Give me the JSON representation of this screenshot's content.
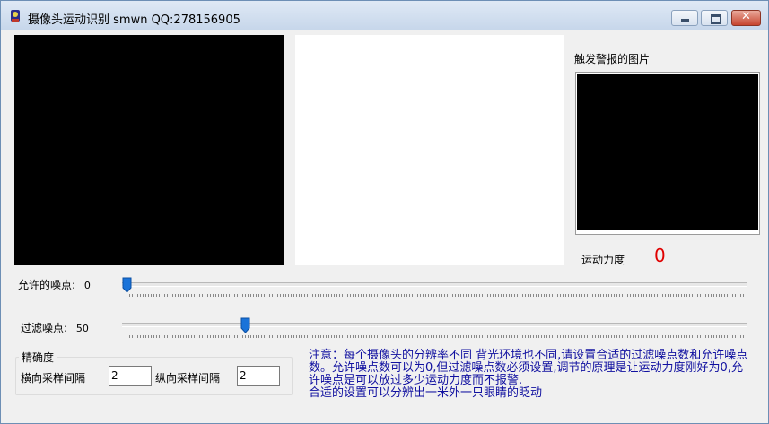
{
  "window": {
    "title": "摄像头运动识别 smwn QQ:278156905"
  },
  "titlebar_buttons": {
    "minimize": "minimize",
    "maximize": "maximize",
    "close": "✕"
  },
  "alarm": {
    "label": "触发警报的图片"
  },
  "force": {
    "label": "运动力度",
    "value": "0"
  },
  "sliders": {
    "allowed_noise": {
      "label": "允许的噪点:",
      "value": "0",
      "level": 0
    },
    "filter_noise": {
      "label": "过滤噪点:",
      "value": "50",
      "level": 0.19
    }
  },
  "precision": {
    "group_title": "精确度",
    "h_label": "横向采样间隔",
    "h_value": "2",
    "v_label": "纵向采样间隔",
    "v_value": "2"
  },
  "note": {
    "text": "注意：每个摄像头的分辨率不同 背光环境也不同,请设置合适的过滤噪点数和允许噪点数。允许噪点数可以为0,但过滤噪点数必须设置,调节的原理是让运动力度刚好为0,允许噪点是可以放过多少运动力度而不报警.\n合适的设置可以分辨出一米外一只眼睛的眨动"
  },
  "colors": {
    "note_text": "#1010a0",
    "force_value": "#e00000",
    "slider_thumb": "#1a73d9"
  }
}
